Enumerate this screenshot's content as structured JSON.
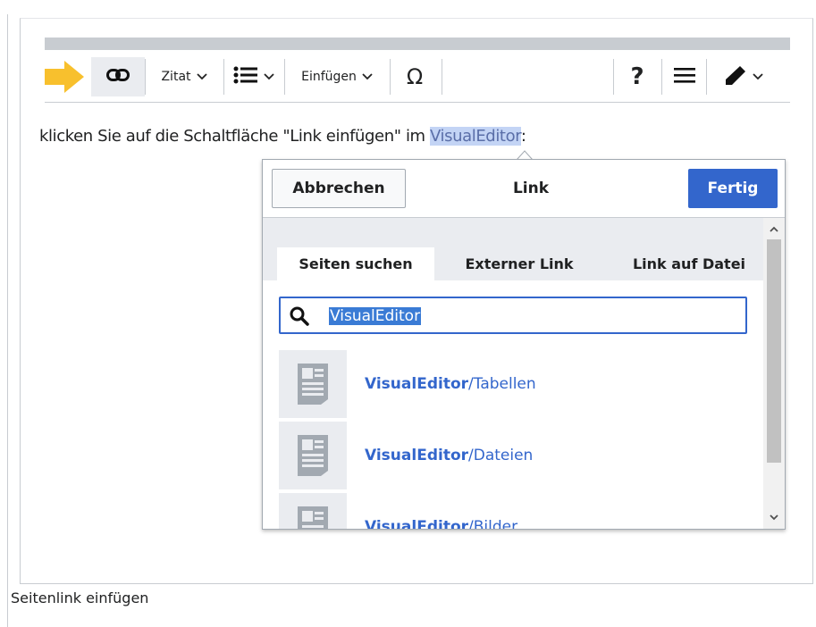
{
  "toolbar": {
    "zitat_label": "Zitat",
    "einfuegen_label": "Einfügen",
    "special_char": "Ω",
    "help_label": "?",
    "icons": [
      "arrow-right-icon",
      "link-icon",
      "chevron-down-icon",
      "bullet-list-icon",
      "menu-icon",
      "pencil-icon"
    ]
  },
  "paragraph": {
    "before": "klicken Sie auf die Schaltfläche \"Link einfügen\" im ",
    "highlight": "VisualEditor",
    "after": ":"
  },
  "dialog": {
    "cancel_label": "Abbrechen",
    "title": "Link",
    "done_label": "Fertig",
    "tabs": [
      {
        "label": "Seiten suchen",
        "active": true
      },
      {
        "label": "Externer Link",
        "active": false
      },
      {
        "label": "Link auf Datei",
        "active": false
      }
    ],
    "search": {
      "value": "VisualEditor"
    },
    "results": [
      {
        "bold": "VisualEditor",
        "rest": "/Tabellen"
      },
      {
        "bold": "VisualEditor",
        "rest": "/Dateien"
      },
      {
        "bold": "VisualEditor",
        "rest": "/Bilder"
      }
    ]
  },
  "caption": "Seitenlink einfügen",
  "colors": {
    "accent": "#3366cc",
    "arrow": "#f8c02d",
    "highlight_bg": "#c3d4f5"
  }
}
